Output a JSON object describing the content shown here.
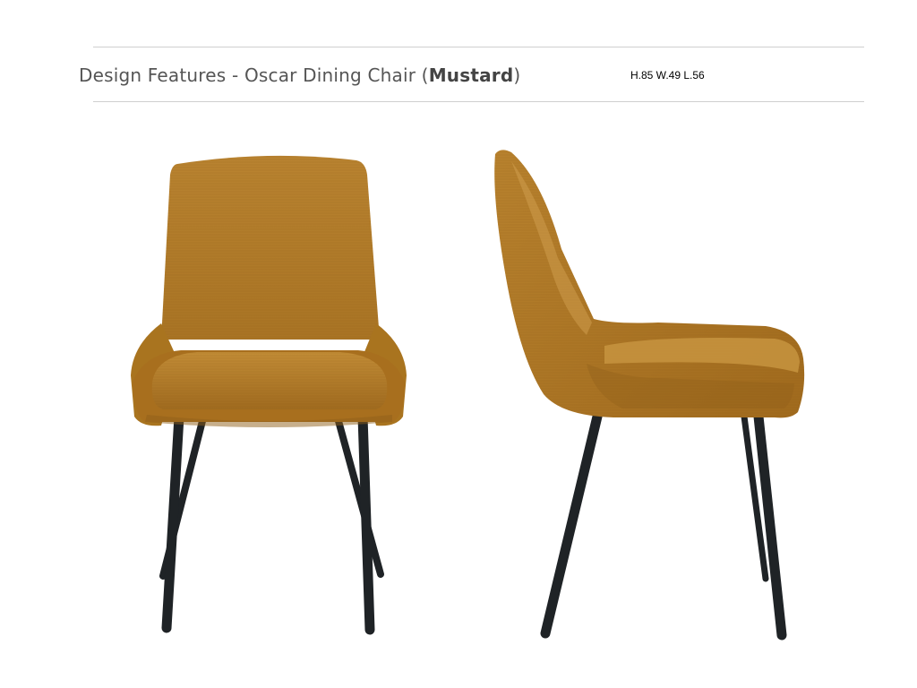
{
  "header": {
    "title_prefix": "Design Features - Oscar Dining Chair (",
    "title_color": "Mustard",
    "title_suffix": ")",
    "dimensions": "H.85 W.49 L.56"
  },
  "colors": {
    "fabric": "#b57f2c",
    "fabric_shadow": "#8f5f1a",
    "fabric_light": "#c9953f",
    "legs": "#1f2326"
  }
}
